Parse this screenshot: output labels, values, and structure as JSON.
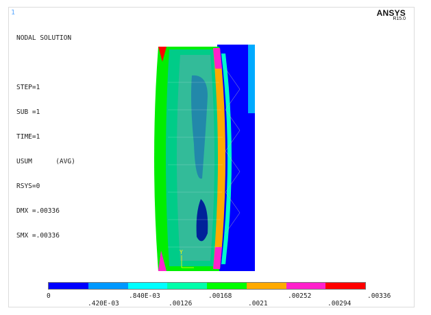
{
  "window_number": "1",
  "brand": {
    "name": "ANSYS",
    "version": "R15.0"
  },
  "info_lines": [
    "NODAL SOLUTION",
    "",
    "STEP=1",
    "SUB =1",
    "TIME=1",
    "USUM      (AVG)",
    "RSYS=0",
    "DMX =.00336",
    "SMX =.00336"
  ],
  "triad": {
    "label": "Y"
  },
  "legend": {
    "colors": [
      "#0000ff",
      "#0099ff",
      "#00ffff",
      "#00ffaa",
      "#00ff00",
      "#ffaa00",
      "#ff22cc",
      "#ff0000"
    ],
    "labels_top": [
      "0",
      ".840E-03",
      ".00168",
      ".00252",
      ".00336"
    ],
    "labels_bottom": [
      ".420E-03",
      ".00126",
      ".0021",
      ".00294"
    ]
  }
}
